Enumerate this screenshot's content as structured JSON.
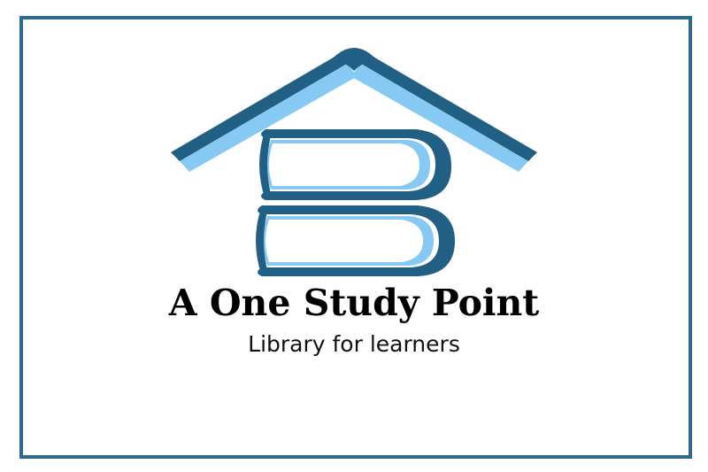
{
  "logo": {
    "title": "A One Study Point",
    "tagline": "Library for learners",
    "icon": "book-house-icon"
  },
  "colors": {
    "frame": "#2e6a8e",
    "dark_blue": "#215f85",
    "light_blue": "#86c9f2",
    "pale_blue": "#cfe9fa",
    "text": "#000000"
  }
}
